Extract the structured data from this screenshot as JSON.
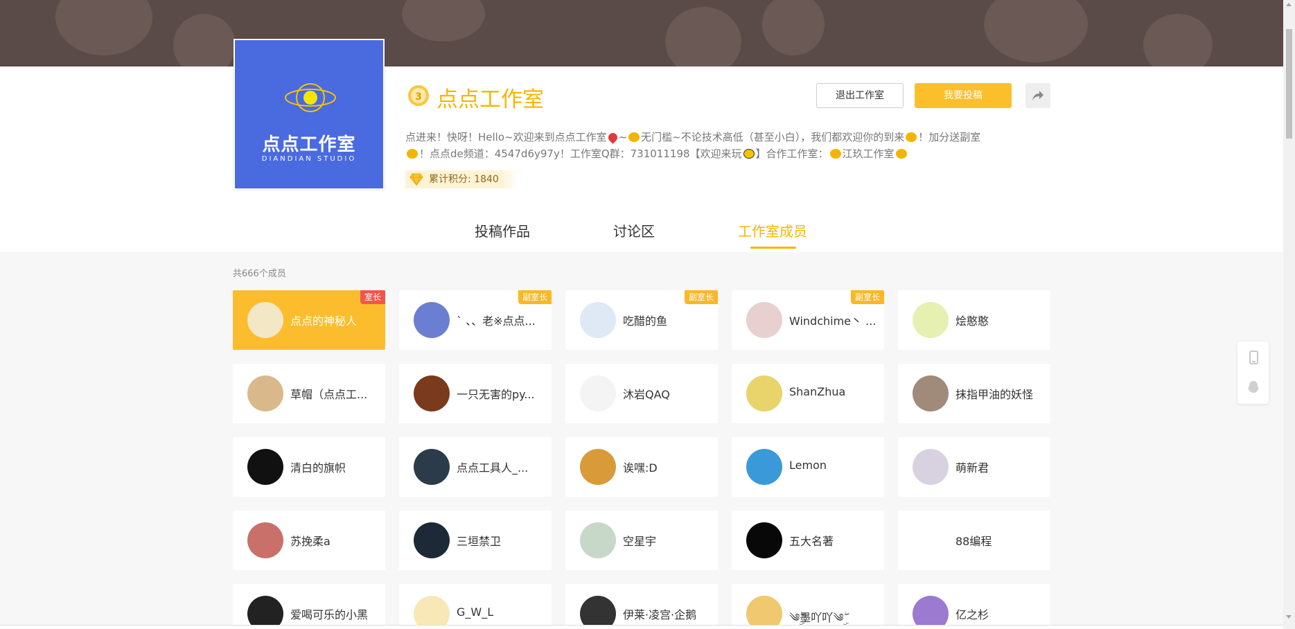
{
  "studio": {
    "name": "点点工作室",
    "level": "3",
    "logo_title": "点点工作室",
    "logo_sub": "DIANDIAN STUDIO",
    "desc_parts": [
      "点进来！快呀！Hello~欢迎来到点点工作室",
      "~",
      "无门槛~不论技术高低（甚至小白），我们都欢迎你的到来",
      "！加分送副室",
      "！点点de频道：4547d6y97y！工作室Q群：731011198【欢迎来玩",
      "】合作工作室：",
      "江玖工作室"
    ],
    "score_label": "累计积分: 1840"
  },
  "buttons": {
    "exit": "退出工作室",
    "submit": "我要投稿",
    "share_icon": "share-icon"
  },
  "tabs": [
    {
      "label": "投稿作品",
      "active": false
    },
    {
      "label": "讨论区",
      "active": false
    },
    {
      "label": "工作室成员",
      "active": true
    }
  ],
  "member_count": "共666个成员",
  "members": [
    {
      "name": "点点的神秘人",
      "role": "室长",
      "owner": true,
      "avatar_color": "#f3e7c6"
    },
    {
      "name": "` 、、老※点点...",
      "role": "副室长",
      "avatar_color": "#6a7fd1"
    },
    {
      "name": "吃醋的鱼",
      "role": "副室长",
      "avatar_color": "#dfe9f5"
    },
    {
      "name": "Windchime丶 ...",
      "role": "副室长",
      "avatar_color": "#e8cfd0"
    },
    {
      "name": "烩憨憨",
      "role": "",
      "avatar_color": "#e6f0b0"
    },
    {
      "name": "草帽（点点工...",
      "role": "",
      "avatar_color": "#d9b98a"
    },
    {
      "name": "一只无害的py...",
      "role": "",
      "avatar_color": "#7a3a1c"
    },
    {
      "name": "沐岩QAQ",
      "role": "",
      "avatar_color": "#f4f4f4"
    },
    {
      "name": "ShanZhua",
      "role": "",
      "avatar_color": "#e8d46a"
    },
    {
      "name": "抹指甲油的妖怪",
      "role": "",
      "avatar_color": "#a08a7a"
    },
    {
      "name": "清白的旗帜",
      "role": "",
      "avatar_color": "#111111"
    },
    {
      "name": "点点工具人_...",
      "role": "",
      "avatar_color": "#2c3b4a"
    },
    {
      "name": "诶嘿:D",
      "role": "",
      "avatar_color": "#d99a3a"
    },
    {
      "name": "Lemon",
      "role": "",
      "avatar_color": "#3a9ad9"
    },
    {
      "name": "萌新君",
      "role": "",
      "avatar_color": "#d8d2e0"
    },
    {
      "name": "苏挽柔a",
      "role": "",
      "avatar_color": "#c9706a"
    },
    {
      "name": "三垣禁卫",
      "role": "",
      "avatar_color": "#1c2a38"
    },
    {
      "name": "空星宇",
      "role": "",
      "avatar_color": "#c8d8c8"
    },
    {
      "name": "五大名著",
      "role": "",
      "avatar_color": "#080808"
    },
    {
      "name": "88编程",
      "role": "",
      "avatar_color": "#ffffff"
    },
    {
      "name": "爱喝可乐的小黑",
      "role": "",
      "avatar_color": "#222222"
    },
    {
      "name": "G_W_L",
      "role": "",
      "avatar_color": "#f8e8b8"
    },
    {
      "name": "伊莱·凌宫·企鹅",
      "role": "",
      "avatar_color": "#333333"
    },
    {
      "name": "༄ۣۖ墨吖吖༄ۣۖ",
      "role": "",
      "avatar_color": "#f0c870"
    },
    {
      "name": "亿之杉",
      "role": "",
      "avatar_color": "#9b7ad0"
    }
  ],
  "colors": {
    "accent": "#f7b500",
    "owner_card": "#fbbd2e",
    "role_badge": "#fbb726",
    "owner_badge": "#f2564a",
    "logo_bg": "#4a6ae0",
    "banner": "#5a4b48"
  },
  "side_icons": [
    "phone-icon",
    "qq-icon"
  ]
}
